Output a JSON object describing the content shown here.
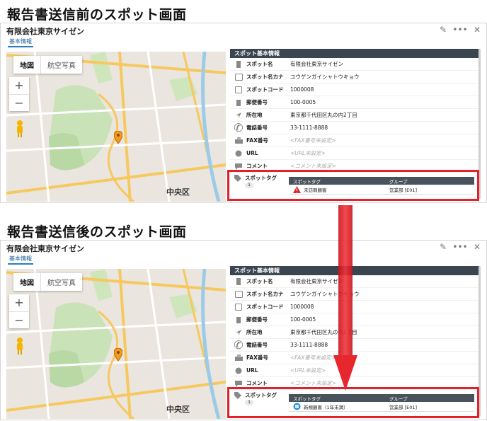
{
  "screens": [
    {
      "heading": "報告書送信前のスポット画面",
      "panel": {
        "title": "有限会社東京サイゼン",
        "tab": "基本情報",
        "map_buttons": [
          "地図",
          "航空写真"
        ],
        "zoom": [
          "+",
          "−"
        ],
        "map_district": "中央区",
        "info_header": "スポット基本情報",
        "rows": [
          {
            "label": "スポット名",
            "value": "有限会社東京サイゼン",
            "icon": "building-icon"
          },
          {
            "label": "スポット名カナ",
            "value": "ユウゲンガイシャトウキョウ",
            "icon": "kana-icon"
          },
          {
            "label": "スポットコード",
            "value": "1000008",
            "icon": "code-icon"
          },
          {
            "label": "郵便番号",
            "value": "100-0005",
            "icon": "postal-icon"
          },
          {
            "label": "所在地",
            "value": "東京都千代田区丸の内2丁目",
            "icon": "location-arrow-icon"
          },
          {
            "label": "電話番号",
            "value": "33-1111-8888",
            "icon": "phone-icon"
          },
          {
            "label": "FAX番号",
            "value": "<FAX番号未設定>",
            "empty": true,
            "icon": "fax-icon"
          },
          {
            "label": "URL",
            "value": "<URL未設定>",
            "empty": true,
            "icon": "globe-icon"
          },
          {
            "label": "コメント",
            "value": "<コメント未設定>",
            "empty": true,
            "icon": "comment-icon"
          }
        ],
        "tag_label": "スポットタグ",
        "tag_count": "1",
        "tag_columns": [
          "スポットタグ",
          "グループ"
        ],
        "tag_row": {
          "tag": "未訪問顧客",
          "group": "営業部 [E01]",
          "icon": "warning-icon"
        }
      }
    },
    {
      "heading": "報告書送信後のスポット画面",
      "panel": {
        "title": "有限会社東京サイゼン",
        "tab": "基本情報",
        "map_buttons": [
          "地図",
          "航空写真"
        ],
        "zoom": [
          "+",
          "−"
        ],
        "map_district": "中央区",
        "info_header": "スポット基本情報",
        "rows": [
          {
            "label": "スポット名",
            "value": "有限会社東京サイゼン",
            "icon": "building-icon"
          },
          {
            "label": "スポット名カナ",
            "value": "ユウゲンガイシャトウキョウ",
            "icon": "kana-icon"
          },
          {
            "label": "スポットコード",
            "value": "1000008",
            "icon": "code-icon"
          },
          {
            "label": "郵便番号",
            "value": "100-0005",
            "icon": "postal-icon"
          },
          {
            "label": "所在地",
            "value": "東京都千代田区丸の内2丁目",
            "icon": "location-arrow-icon"
          },
          {
            "label": "電話番号",
            "value": "33-1111-8888",
            "icon": "phone-icon"
          },
          {
            "label": "FAX番号",
            "value": "<FAX番号未設定>",
            "empty": true,
            "icon": "fax-icon"
          },
          {
            "label": "URL",
            "value": "<URL未設定>",
            "empty": true,
            "icon": "globe-icon"
          },
          {
            "label": "コメント",
            "value": "<コメント未設定>",
            "empty": true,
            "icon": "comment-icon"
          }
        ],
        "tag_label": "スポットタグ",
        "tag_count": "1",
        "tag_columns": [
          "スポットタグ",
          "グループ"
        ],
        "tag_row": {
          "tag": "新規顧客（1年未満）",
          "group": "営業部 [E01]",
          "icon": "new-badge-icon"
        }
      }
    }
  ],
  "colors": {
    "highlight": "#e5202b",
    "arrow": "#e8262e",
    "header_bg": "#3b4550",
    "tab_accent": "#2b7ec2"
  }
}
